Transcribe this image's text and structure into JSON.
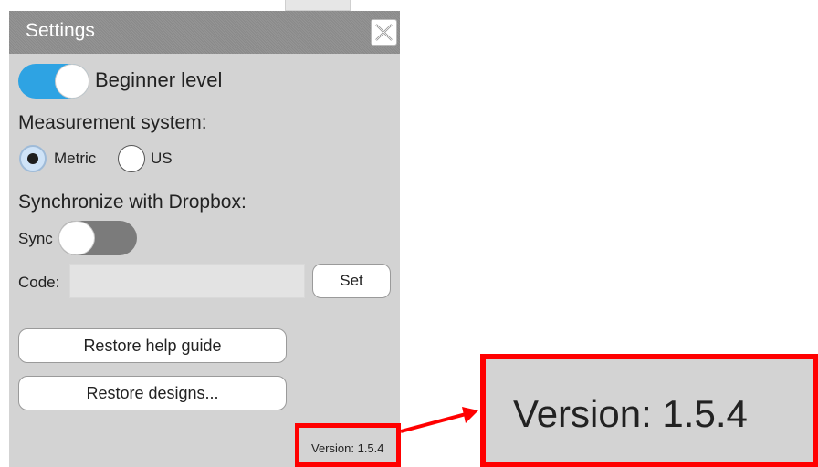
{
  "dialog": {
    "title": "Settings",
    "close_icon": "close-x-icon"
  },
  "beginner": {
    "label": "Beginner level",
    "enabled": true,
    "accent": "#2ea3e3"
  },
  "measurement": {
    "heading": "Measurement system:",
    "options": [
      {
        "label": "Metric",
        "selected": true
      },
      {
        "label": "US",
        "selected": false
      }
    ]
  },
  "sync": {
    "heading": "Synchronize with Dropbox:",
    "toggle_label": "Sync",
    "enabled": false,
    "code_label": "Code:",
    "code_value": "",
    "set_label": "Set"
  },
  "actions": {
    "restore_help_label": "Restore help guide",
    "restore_designs_label": "Restore designs..."
  },
  "version": {
    "text": "Version: 1.5.4"
  },
  "callout": {
    "text": "Version: 1.5.4",
    "highlight_color": "#ff0000"
  }
}
